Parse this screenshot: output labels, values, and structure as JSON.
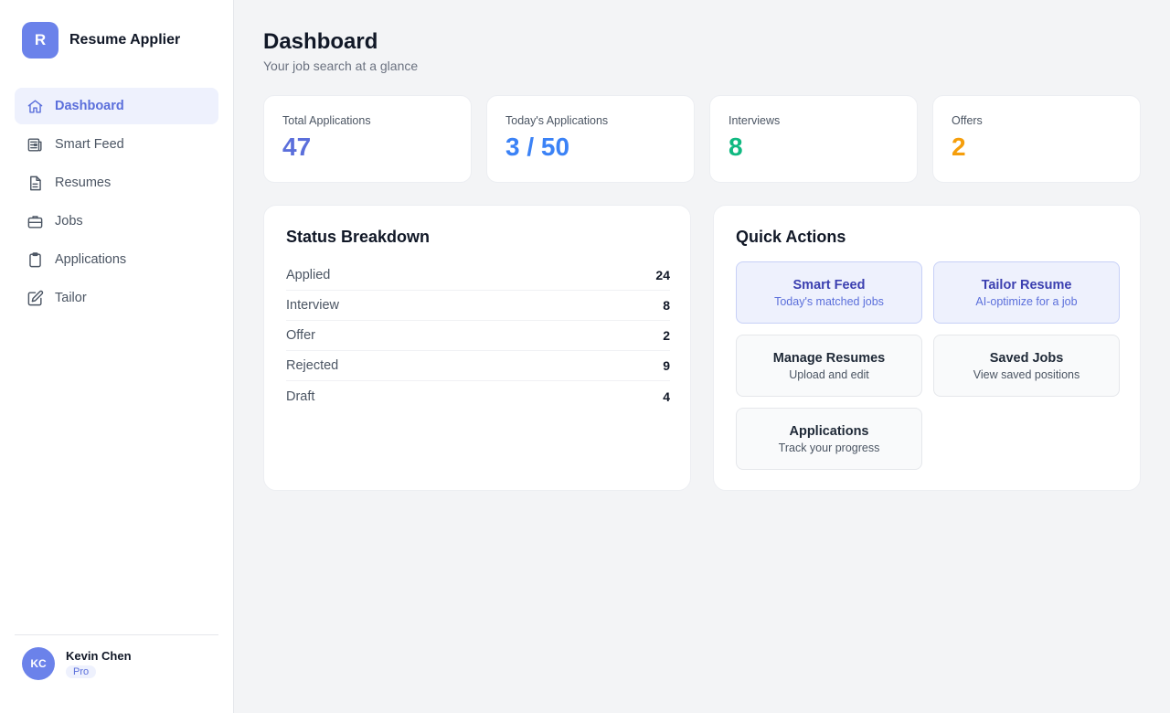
{
  "brand": {
    "logo_letter": "R",
    "name": "Resume Applier"
  },
  "nav": [
    {
      "label": "Dashboard",
      "icon": "home-icon",
      "active": true
    },
    {
      "label": "Smart Feed",
      "icon": "newspaper-icon"
    },
    {
      "label": "Resumes",
      "icon": "document-icon"
    },
    {
      "label": "Jobs",
      "icon": "briefcase-icon"
    },
    {
      "label": "Applications",
      "icon": "clipboard-icon"
    },
    {
      "label": "Tailor",
      "icon": "edit-icon"
    }
  ],
  "user": {
    "initials": "KC",
    "name": "Kevin Chen",
    "plan": "Pro"
  },
  "page": {
    "title": "Dashboard",
    "subtitle": "Your job search at a glance"
  },
  "stats": [
    {
      "label": "Total Applications",
      "value": "47",
      "color": "#5b6fdb"
    },
    {
      "label": "Today's Applications",
      "value": "3 / 50",
      "color": "#3b82f6"
    },
    {
      "label": "Interviews",
      "value": "8",
      "color": "#10b981"
    },
    {
      "label": "Offers",
      "value": "2",
      "color": "#f59e0b"
    }
  ],
  "status_breakdown": {
    "title": "Status Breakdown",
    "rows": [
      {
        "name": "Applied",
        "count": "24"
      },
      {
        "name": "Interview",
        "count": "8"
      },
      {
        "name": "Offer",
        "count": "2"
      },
      {
        "name": "Rejected",
        "count": "9"
      },
      {
        "name": "Draft",
        "count": "4"
      }
    ]
  },
  "quick_actions": {
    "title": "Quick Actions",
    "items": [
      {
        "title": "Smart Feed",
        "desc": "Today's matched jobs",
        "primary": true
      },
      {
        "title": "Tailor Resume",
        "desc": "AI-optimize for a job",
        "primary": true
      },
      {
        "title": "Manage Resumes",
        "desc": "Upload and edit"
      },
      {
        "title": "Saved Jobs",
        "desc": "View saved positions"
      },
      {
        "title": "Applications",
        "desc": "Track your progress"
      }
    ]
  }
}
